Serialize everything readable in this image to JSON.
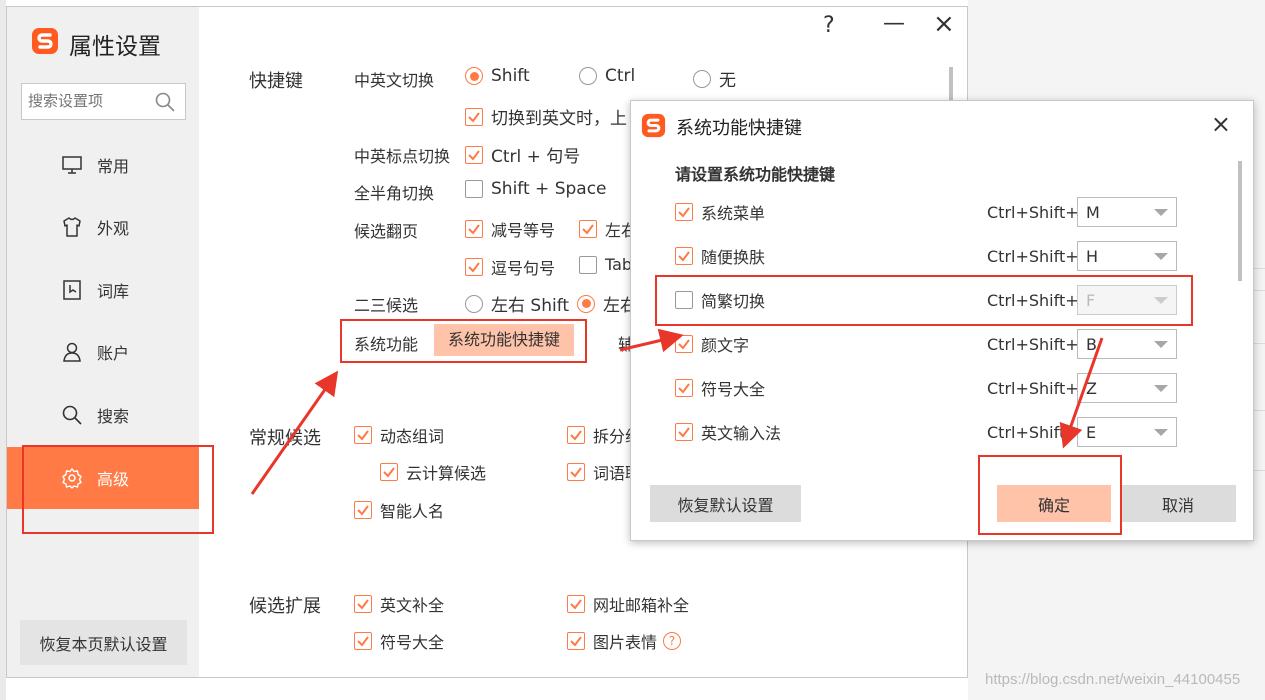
{
  "sidebar": {
    "title": "属性设置",
    "search_placeholder": "搜索设置项",
    "items": [
      {
        "label": "常用"
      },
      {
        "label": "外观"
      },
      {
        "label": "词库"
      },
      {
        "label": "账户"
      },
      {
        "label": "搜索"
      },
      {
        "label": "高级"
      }
    ],
    "restore_label": "恢复本页默认设置"
  },
  "window": {
    "help": "?",
    "minimize": "—",
    "close": "×"
  },
  "shortcut_section": {
    "label": "快捷键",
    "cn_en_switch": {
      "label": "中英文切换",
      "options": [
        "Shift",
        "Ctrl",
        "无"
      ],
      "selected": "Shift"
    },
    "switch_hint": "切换到英文时，上",
    "punct_switch": {
      "label": "中英标点切换",
      "option": "Ctrl + 句号"
    },
    "fullhalf": {
      "label": "全半角切换",
      "option": "Shift + Space"
    },
    "paging": {
      "label": "候选翻页",
      "opt1": "减号等号",
      "opt2": "左右",
      "opt3": "逗号句号",
      "opt4": "Tab"
    },
    "secondthird": {
      "label": "二三候选",
      "opt1": "左右 Shift",
      "opt2": "左右"
    },
    "system": {
      "label": "系统功能",
      "button": "系统功能快捷键",
      "aux": "辅"
    }
  },
  "general_section": {
    "label": "常规候选",
    "opt1": "动态组词",
    "opt2": "拆分组",
    "opt3": "云计算候选",
    "opt4": "词语联",
    "opt5": "智能人名"
  },
  "extend_section": {
    "label": "候选扩展",
    "opt1": "英文补全",
    "opt2": "网址邮箱补全",
    "opt3": "符号大全",
    "opt4": "图片表情"
  },
  "dialog": {
    "title": "系统功能快捷键",
    "close": "×",
    "subtitle": "请设置系统功能快捷键",
    "rows": [
      {
        "name": "系统菜单",
        "modifier": "Ctrl+Shift+",
        "key": "M",
        "checked": true
      },
      {
        "name": "随便换肤",
        "modifier": "Ctrl+Shift+",
        "key": "H",
        "checked": true
      },
      {
        "name": "简繁切换",
        "modifier": "Ctrl+Shift+",
        "key": "F",
        "checked": false
      },
      {
        "name": "颜文字",
        "modifier": "Ctrl+Shift+",
        "key": "B",
        "checked": true
      },
      {
        "name": "符号大全",
        "modifier": "Ctrl+Shift+",
        "key": "Z",
        "checked": true
      },
      {
        "name": "英文输入法",
        "modifier": "Ctrl+Shift+",
        "key": "E",
        "checked": true
      }
    ],
    "restore_label": "恢复默认设置",
    "ok_label": "确定",
    "cancel_label": "取消"
  },
  "watermark": "https://blog.csdn.net/weixin_44100455",
  "colors": {
    "accent": "#ff7a45",
    "accent_light": "#ffc3aa",
    "annotation": "#e8372a"
  }
}
